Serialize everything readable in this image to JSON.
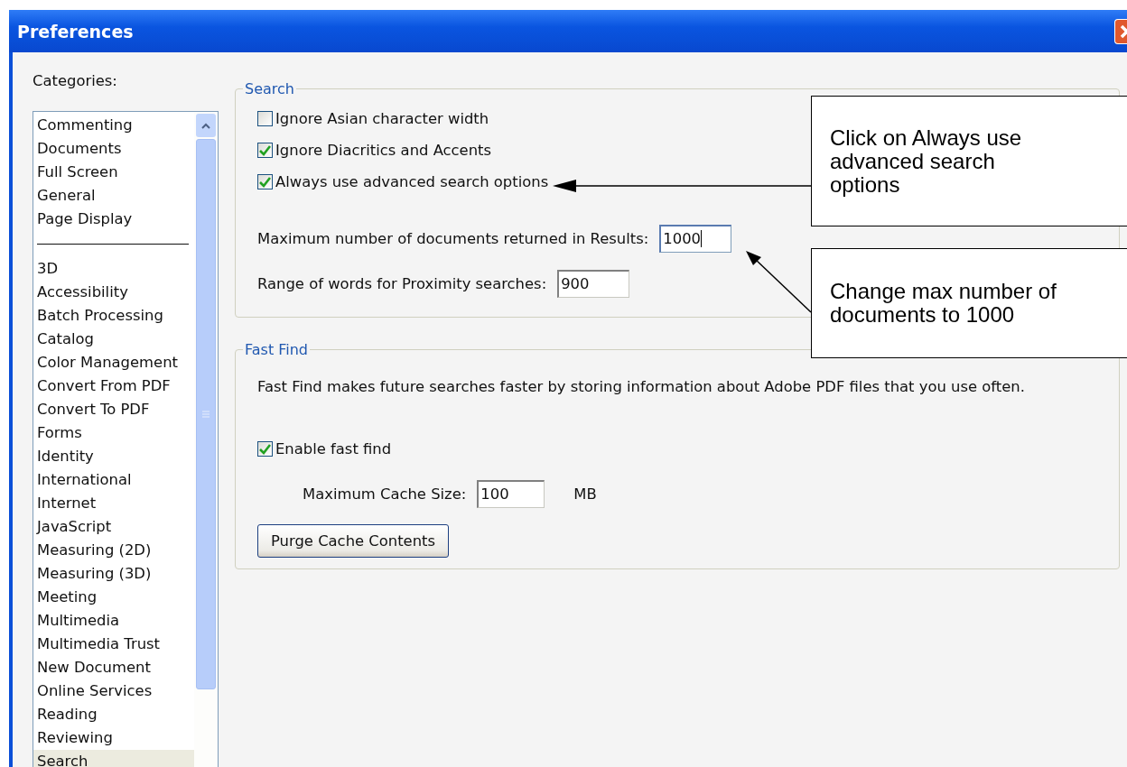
{
  "window": {
    "title": "Preferences"
  },
  "categories": {
    "label": "Categories:",
    "items": [
      {
        "kind": "item",
        "label": "Commenting",
        "selected": false
      },
      {
        "kind": "item",
        "label": "Documents",
        "selected": false
      },
      {
        "kind": "item",
        "label": "Full Screen",
        "selected": false
      },
      {
        "kind": "item",
        "label": "General",
        "selected": false
      },
      {
        "kind": "item",
        "label": "Page Display",
        "selected": false
      },
      {
        "kind": "separator"
      },
      {
        "kind": "item",
        "label": "3D",
        "selected": false
      },
      {
        "kind": "item",
        "label": "Accessibility",
        "selected": false
      },
      {
        "kind": "item",
        "label": "Batch Processing",
        "selected": false
      },
      {
        "kind": "item",
        "label": "Catalog",
        "selected": false
      },
      {
        "kind": "item",
        "label": "Color Management",
        "selected": false
      },
      {
        "kind": "item",
        "label": "Convert From PDF",
        "selected": false
      },
      {
        "kind": "item",
        "label": "Convert To PDF",
        "selected": false
      },
      {
        "kind": "item",
        "label": "Forms",
        "selected": false
      },
      {
        "kind": "item",
        "label": "Identity",
        "selected": false
      },
      {
        "kind": "item",
        "label": "International",
        "selected": false
      },
      {
        "kind": "item",
        "label": "Internet",
        "selected": false
      },
      {
        "kind": "item",
        "label": "JavaScript",
        "selected": false
      },
      {
        "kind": "item",
        "label": "Measuring (2D)",
        "selected": false
      },
      {
        "kind": "item",
        "label": "Measuring (3D)",
        "selected": false
      },
      {
        "kind": "item",
        "label": "Meeting",
        "selected": false
      },
      {
        "kind": "item",
        "label": "Multimedia",
        "selected": false
      },
      {
        "kind": "item",
        "label": "Multimedia Trust",
        "selected": false
      },
      {
        "kind": "item",
        "label": "New Document",
        "selected": false
      },
      {
        "kind": "item",
        "label": "Online Services",
        "selected": false
      },
      {
        "kind": "item",
        "label": "Reading",
        "selected": false
      },
      {
        "kind": "item",
        "label": "Reviewing",
        "selected": false
      },
      {
        "kind": "item",
        "label": "Search",
        "selected": true
      }
    ]
  },
  "search": {
    "legend": "Search",
    "checkboxes": [
      {
        "label": "Ignore Asian character width",
        "checked": false
      },
      {
        "label": "Ignore Diacritics and Accents",
        "checked": true
      },
      {
        "label": "Always use advanced search options",
        "checked": true
      }
    ],
    "fields": [
      {
        "label": "Maximum number of documents returned in Results:",
        "value": "1000",
        "focused": true
      },
      {
        "label": "Range of words for Proximity searches:",
        "value": "900",
        "focused": false
      }
    ]
  },
  "fast_find": {
    "legend": "Fast Find",
    "description": "Fast Find makes future searches faster by storing information about Adobe PDF files that you use often.",
    "checkbox": {
      "label": "Enable fast find",
      "checked": true
    },
    "cache_field": {
      "label": "Maximum Cache Size:",
      "value": "100",
      "unit": "MB"
    },
    "button": "Purge Cache Contents"
  },
  "callouts": [
    {
      "text": "Click on Always use advanced search options"
    },
    {
      "text": "Change max number of documents to 1000"
    }
  ]
}
